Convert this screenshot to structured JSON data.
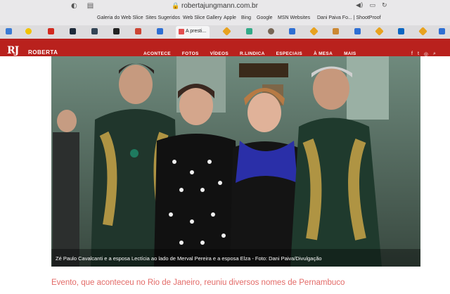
{
  "browser": {
    "url": "robertajungmann.com.br",
    "bookmarks": [
      "Galeria do Web Slice",
      "Sites Sugeridos",
      "Web Slice Gallery",
      "Apple",
      "Bing",
      "Google",
      "MSN Websites",
      "Dani Paiva Fo... | ShootProof"
    ],
    "active_tab_label": "A presti..."
  },
  "site": {
    "logo_initials": "RJ",
    "logo_name": "ROBERTA",
    "menu": [
      "ACONTECE",
      "FOTOS",
      "VÍDEOS",
      "R.LINDICA",
      "ESPECIAIS",
      "À MESA",
      "MAIS"
    ]
  },
  "article": {
    "photo_caption": "Zé Paulo Cavalcanti e a esposa Lectícia ao lado de Merval Pereira e a esposa Elza - Foto: Dani Paiva/Divulgação",
    "subheading": "Evento, que aconteceu no Rio de Janeiro, reuniu diversos nomes de Pernambuco"
  },
  "colors": {
    "brand_red": "#b9211d",
    "subheading": "#e36b68"
  }
}
